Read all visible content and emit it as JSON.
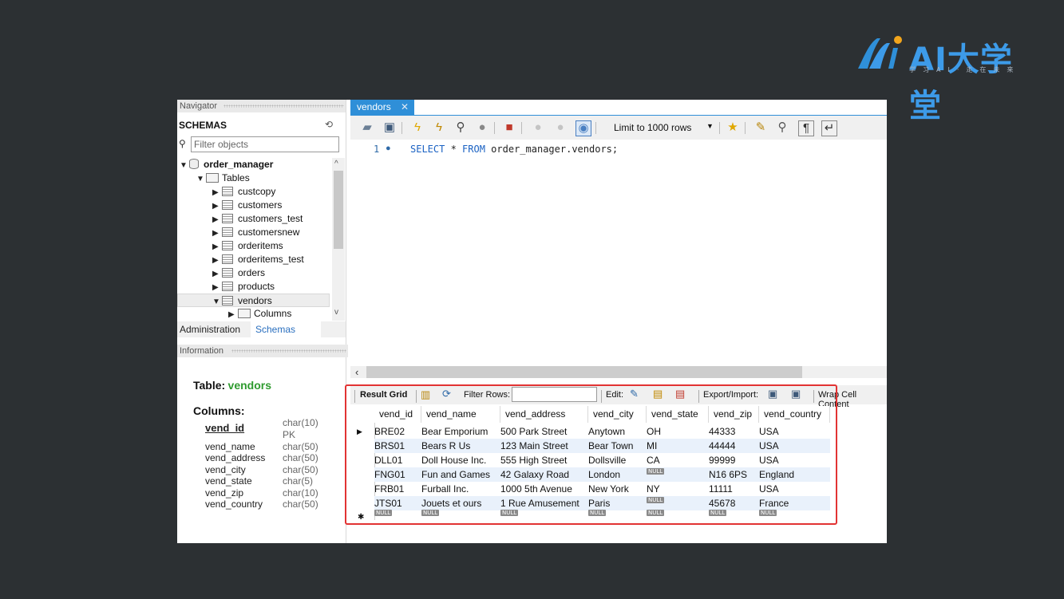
{
  "logo": {
    "text": "AI大学堂",
    "tagline": "学习AI·走在未来"
  },
  "navigator": {
    "header": "Navigator",
    "schemas_label": "SCHEMAS",
    "filter_placeholder": "Filter objects",
    "tree": {
      "schema": "order_manager",
      "tables_label": "Tables",
      "tables": [
        "custcopy",
        "customers",
        "customers_test",
        "customersnew",
        "orderitems",
        "orderitems_test",
        "orders",
        "products",
        "vendors"
      ],
      "expanded_child": "Columns"
    },
    "tabs": {
      "administration": "Administration",
      "schemas": "Schemas"
    },
    "info_header": "Information",
    "info": {
      "table_label": "Table:",
      "table_name": "vendors",
      "columns_label": "Columns:",
      "columns": [
        {
          "name": "vend_id",
          "type": "char(10)",
          "extra": "PK"
        },
        {
          "name": "vend_name",
          "type": "char(50)"
        },
        {
          "name": "vend_address",
          "type": "char(50)"
        },
        {
          "name": "vend_city",
          "type": "char(50)"
        },
        {
          "name": "vend_state",
          "type": "char(5)"
        },
        {
          "name": "vend_zip",
          "type": "char(10)"
        },
        {
          "name": "vend_country",
          "type": "char(50)"
        }
      ]
    }
  },
  "editor": {
    "tab_label": "vendors",
    "limit_label": "Limit to 1000 rows",
    "line_number": "1",
    "sql": {
      "kw_select": "SELECT",
      "star": " * ",
      "kw_from": "FROM",
      "rest": " order_manager.vendors;"
    }
  },
  "result": {
    "toolbar": {
      "grid_label": "Result Grid",
      "filter_label": "Filter Rows:",
      "edit_label": "Edit:",
      "export_label": "Export/Import:",
      "wrap_label": "Wrap Cell Content"
    },
    "columns": [
      "vend_id",
      "vend_name",
      "vend_address",
      "vend_city",
      "vend_state",
      "vend_zip",
      "vend_country"
    ],
    "rows": [
      [
        "BRE02",
        "Bear Emporium",
        "500 Park Street",
        "Anytown",
        "OH",
        "44333",
        "USA"
      ],
      [
        "BRS01",
        "Bears R Us",
        "123 Main Street",
        "Bear Town",
        "MI",
        "44444",
        "USA"
      ],
      [
        "DLL01",
        "Doll House Inc.",
        "555 High Street",
        "Dollsville",
        "CA",
        "99999",
        "USA"
      ],
      [
        "FNG01",
        "Fun and Games",
        "42 Galaxy Road",
        "London",
        "NULL",
        "N16 6PS",
        "England"
      ],
      [
        "FRB01",
        "Furball Inc.",
        "1000 5th Avenue",
        "New York",
        "NY",
        "11111",
        "USA"
      ],
      [
        "JTS01",
        "Jouets et ours",
        "1 Rue Amusement",
        "Paris",
        "NULL",
        "45678",
        "France"
      ]
    ],
    "null_label": "NULL"
  },
  "colors": {
    "accent": "#2f8fd8",
    "highlight": "#e23333",
    "table_name": "#2f9b2f",
    "background": "#2c3033"
  }
}
